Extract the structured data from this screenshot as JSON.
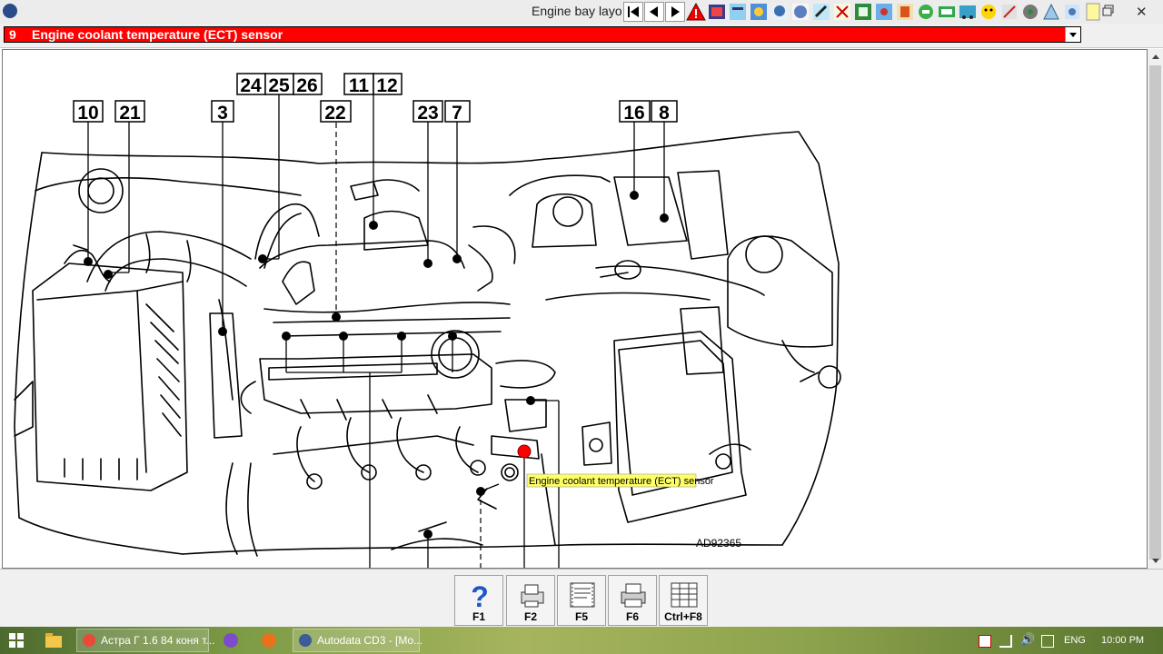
{
  "window": {
    "title": "Engine bay layo"
  },
  "selector": {
    "number": "9",
    "label": "Engine coolant temperature (ECT) sensor"
  },
  "toolbar_icons": [
    "first-page-icon",
    "previous-icon",
    "next-icon",
    "warning-icon",
    "book-icon",
    "map-icon",
    "gear-icon",
    "hand-icon",
    "globe-icon",
    "wrench-icon",
    "person-icon",
    "document-icon",
    "pump-icon",
    "phone-icon",
    "pen-icon",
    "rotate-icon",
    "car-icon",
    "smiley-icon",
    "tools-icon",
    "circuit-icon",
    "cone-icon",
    "tooth-icon",
    "note-icon"
  ],
  "diagram": {
    "callouts": [
      {
        "id": "callout-10",
        "text": "10"
      },
      {
        "id": "callout-21",
        "text": "21"
      },
      {
        "id": "callout-3",
        "text": "3"
      },
      {
        "id": "callout-24",
        "text": "24"
      },
      {
        "id": "callout-25",
        "text": "25"
      },
      {
        "id": "callout-26",
        "text": "26"
      },
      {
        "id": "callout-22",
        "text": "22"
      },
      {
        "id": "callout-11",
        "text": "11"
      },
      {
        "id": "callout-12",
        "text": "12"
      },
      {
        "id": "callout-23",
        "text": "23"
      },
      {
        "id": "callout-7",
        "text": "7"
      },
      {
        "id": "callout-16",
        "text": "16"
      },
      {
        "id": "callout-8",
        "text": "8"
      }
    ],
    "tooltip": "Engine coolant temperature (ECT) sensor",
    "ref_code": "AD92365"
  },
  "fkeys": [
    {
      "label": "F1",
      "icon": "help-icon"
    },
    {
      "label": "F2",
      "icon": "print-preview-icon"
    },
    {
      "label": "F5",
      "icon": "notes-icon"
    },
    {
      "label": "F6",
      "icon": "printer-icon"
    },
    {
      "label": "Ctrl+F8",
      "icon": "list-icon"
    }
  ],
  "taskbar": {
    "items": [
      {
        "label": "Астра Г 1.6 84 коня т..."
      },
      {
        "label": "Autodata CD3 - [Mo..."
      }
    ],
    "language": "ENG",
    "time": "10:00 PM"
  },
  "colors": {
    "selector_bg": "#ff0000",
    "tooltip_bg": "#ffff66",
    "marker": "#ff0000"
  }
}
